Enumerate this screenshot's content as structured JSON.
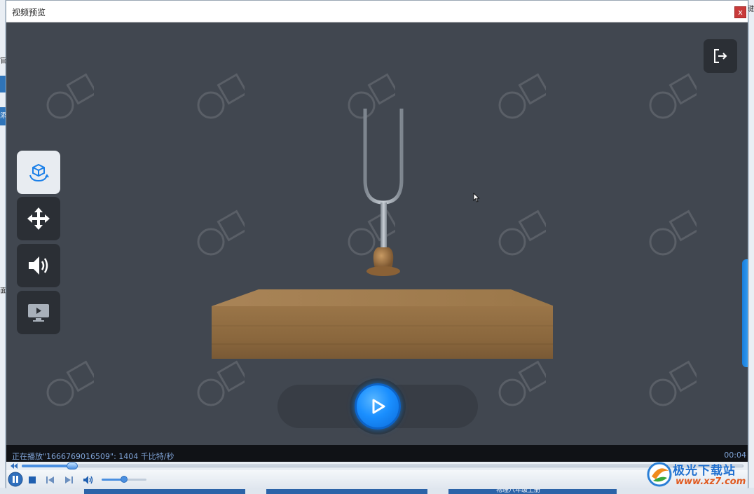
{
  "window": {
    "title": "视频预览",
    "close_label": "x"
  },
  "background_app": {
    "left_fragments": [
      "官",
      "添",
      "面"
    ],
    "right_fragments": [
      "键"
    ],
    "bottom_fragment": "物理八年级上册"
  },
  "viewer": {
    "tools": [
      {
        "name": "rotate-view",
        "icon": "cube-rotate-icon",
        "active": true
      },
      {
        "name": "move",
        "icon": "move-arrows-icon",
        "active": false
      },
      {
        "name": "sound",
        "icon": "speaker-icon",
        "active": false
      },
      {
        "name": "screen",
        "icon": "monitor-play-icon",
        "active": false
      }
    ],
    "exit_icon": "exit-icon",
    "play_icon": "play-icon"
  },
  "player": {
    "status_text": "正在播放\"1666769016509\": 1404 千比特/秒",
    "time_text": "00:04",
    "progress_fraction": 0.07,
    "volume_fraction": 0.5
  },
  "watermark": {
    "logo": "jiguang-logo",
    "title": "极光下载站",
    "url": "www.xz7.com"
  },
  "colors": {
    "scene_bg": "#414750",
    "accent_blue": "#1a8fff",
    "status_text": "#7fa3d6",
    "close_red": "#c83a3a"
  }
}
